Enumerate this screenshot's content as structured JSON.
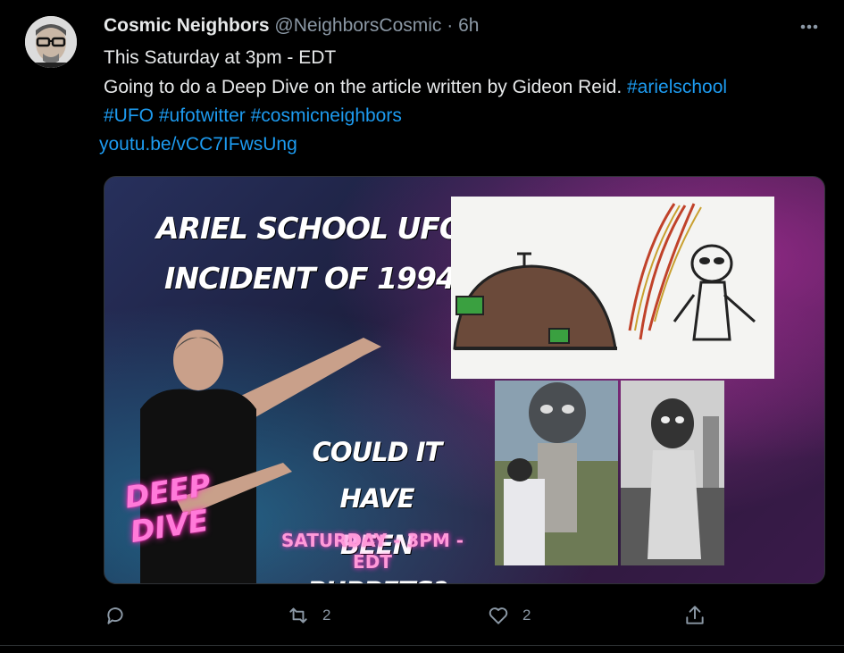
{
  "tweet": {
    "author_name": "Cosmic Neighbors",
    "handle": "@NeighborsCosmic",
    "separator": "·",
    "time": "6h",
    "line1": "This Saturday at 3pm - EDT",
    "line2_text": "Going to do a Deep Dive on the article written by Gideon Reid.",
    "hashtag_arielschool": "#arielschool",
    "hashtag_ufo": "#UFO",
    "hashtag_ufotwitter": "#ufotwitter",
    "hashtag_cosmicneighbors": "#cosmicneighbors",
    "link": "youtu.be/vCC7IFwsUng"
  },
  "media": {
    "title_line1": "ARIEL SCHOOL UFO",
    "title_line2": "INCIDENT OF 1994",
    "puppets_line1": "COULD IT HAVE",
    "puppets_line2": "BEEN PUPPETS?",
    "deep_dive": "DEEP DIVE",
    "schedule": "SATURDAY - 3PM -EDT"
  },
  "actions": {
    "reply_count": "",
    "retweet_count": "2",
    "like_count": "2"
  },
  "colors": {
    "background": "#000000",
    "link": "#1d9bf0",
    "muted": "#8b98a5",
    "neon_pink": "#ff7ad9"
  },
  "icons": [
    "more-icon",
    "reply-icon",
    "retweet-icon",
    "like-icon",
    "share-icon"
  ]
}
